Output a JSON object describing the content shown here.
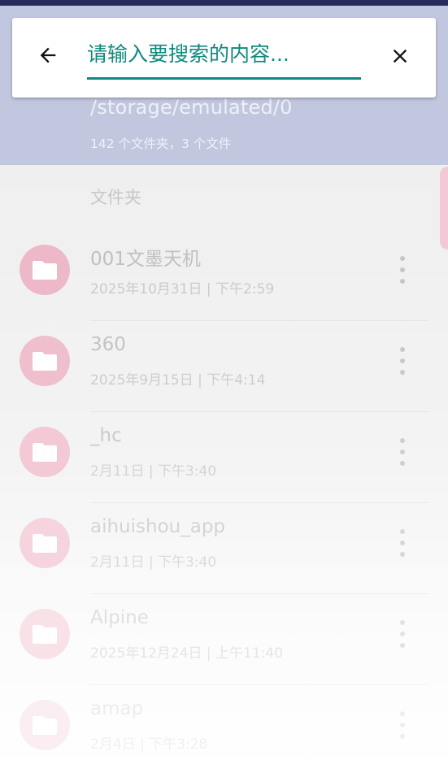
{
  "header": {
    "path": "/storage/emulated/0",
    "summary": "142 个文件夹，3 个文件"
  },
  "search": {
    "placeholder": "请输入要搜索的内容..."
  },
  "section": {
    "label": "文件夹"
  },
  "folders": [
    {
      "name": "001文墨天机",
      "date": "2025年10月31日 | 下午2:59"
    },
    {
      "name": "360",
      "date": "2025年9月15日 | 下午4:14"
    },
    {
      "name": "_hc",
      "date": "2月11日 | 下午3:40"
    },
    {
      "name": "aihuishou_app",
      "date": "2月11日 | 下午3:40"
    },
    {
      "name": "Alpine",
      "date": "2025年12月24日 | 上午11:40"
    },
    {
      "name": "amap",
      "date": "2月4日 | 下午3:28"
    }
  ],
  "colors": {
    "accent": "#0f8a7e",
    "header_bg": "#c2c7e0",
    "statusbar": "#262a5c",
    "folder_circle": "#e8b4c4"
  },
  "icons": {
    "back": "arrow-left-icon",
    "clear": "close-icon",
    "folder": "folder-icon",
    "more": "more-vertical-icon"
  }
}
